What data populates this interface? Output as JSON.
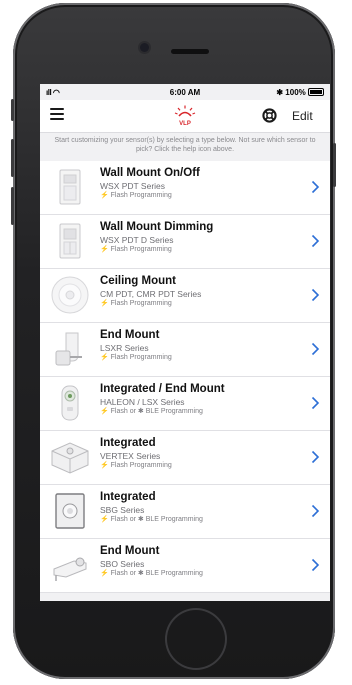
{
  "status": {
    "signal": "ıll",
    "time": "6:00 AM",
    "bluetooth": "✱",
    "battery": "100%"
  },
  "nav": {
    "logo_text": "VLP",
    "edit_label": "Edit",
    "menu_icon": "hamburger-icon",
    "help_icon": "lifebuoy-icon"
  },
  "hint": "Start customizing your sensor(s) by selecting a type below. Not sure which sensor to pick? Click the help icon above.",
  "colors": {
    "accent": "#2d6fd6",
    "logo_red": "#d8262b"
  },
  "sensors": [
    {
      "title": "Wall Mount On/Off",
      "series": "WSX PDT Series",
      "programming": "⚡ Flash Programming"
    },
    {
      "title": "Wall Mount Dimming",
      "series": "WSX PDT D Series",
      "programming": "⚡ Flash Programming"
    },
    {
      "title": "Ceiling Mount",
      "series": "CM PDT, CMR PDT Series",
      "programming": "⚡ Flash Programming"
    },
    {
      "title": "End Mount",
      "series": "LSXR Series",
      "programming": "⚡ Flash Programming"
    },
    {
      "title": "Integrated / End Mount",
      "series": "HALEON / LSX Series",
      "programming": "⚡ Flash or ✱ BLE Programming"
    },
    {
      "title": "Integrated",
      "series": "VERTEX Series",
      "programming": "⚡ Flash Programming"
    },
    {
      "title": "Integrated",
      "series": "SBG Series",
      "programming": "⚡ Flash or ✱ BLE Programming"
    },
    {
      "title": "End Mount",
      "series": "SBO Series",
      "programming": "⚡ Flash or ✱ BLE Programming"
    }
  ]
}
